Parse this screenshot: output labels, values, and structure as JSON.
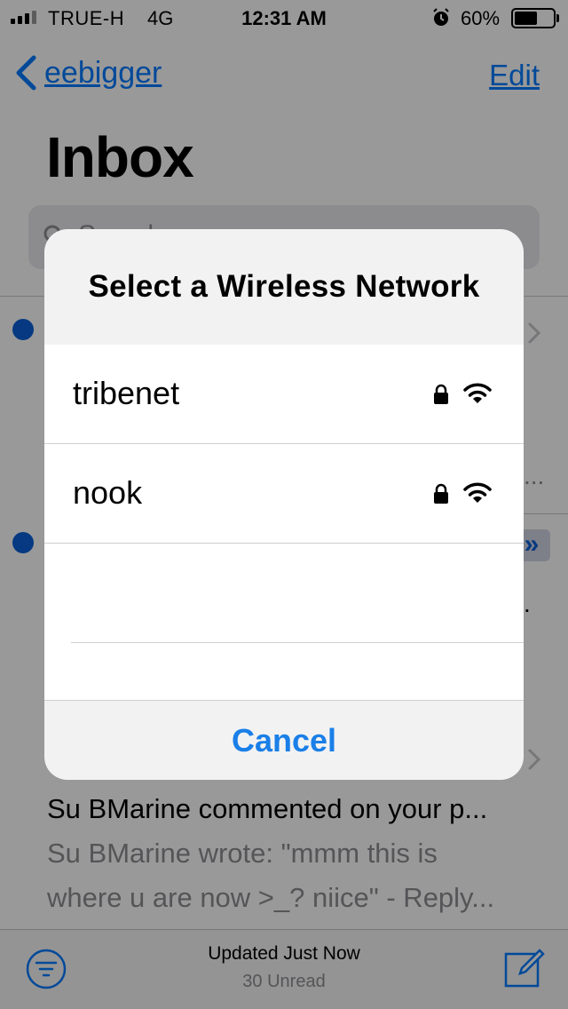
{
  "status_bar": {
    "carrier": "TRUE-H",
    "network": "4G",
    "time": "12:31 AM",
    "battery": "60%",
    "battery_level": 0.6,
    "signal_bars": 3,
    "alarm_icon": "alarm-icon"
  },
  "nav": {
    "back_label": "eebigger",
    "edit_label": "Edit",
    "title": "Inbox"
  },
  "search": {
    "placeholder": "Search"
  },
  "message": {
    "subject": "Su BMarine commented on your p...",
    "preview_line1": "Su BMarine wrote: \"mmm this is",
    "preview_line2": "where u are now >_? niice\" - Reply...",
    "ellipsis": "..."
  },
  "toolbar": {
    "updated": "Updated Just Now",
    "unread": "30 Unread"
  },
  "alert": {
    "title": "Select a Wireless Network",
    "networks": [
      {
        "name": "tribenet",
        "secured": true,
        "icon": "wifi-icon"
      },
      {
        "name": "nook",
        "secured": true,
        "icon": "wifi-icon"
      }
    ],
    "cancel_label": "Cancel"
  },
  "colors": {
    "accent": "#007aff",
    "unread_dot": "#0a60d8",
    "overlay": "rgba(0,0,0,0.4)",
    "cancel": "#1a7fe8"
  }
}
